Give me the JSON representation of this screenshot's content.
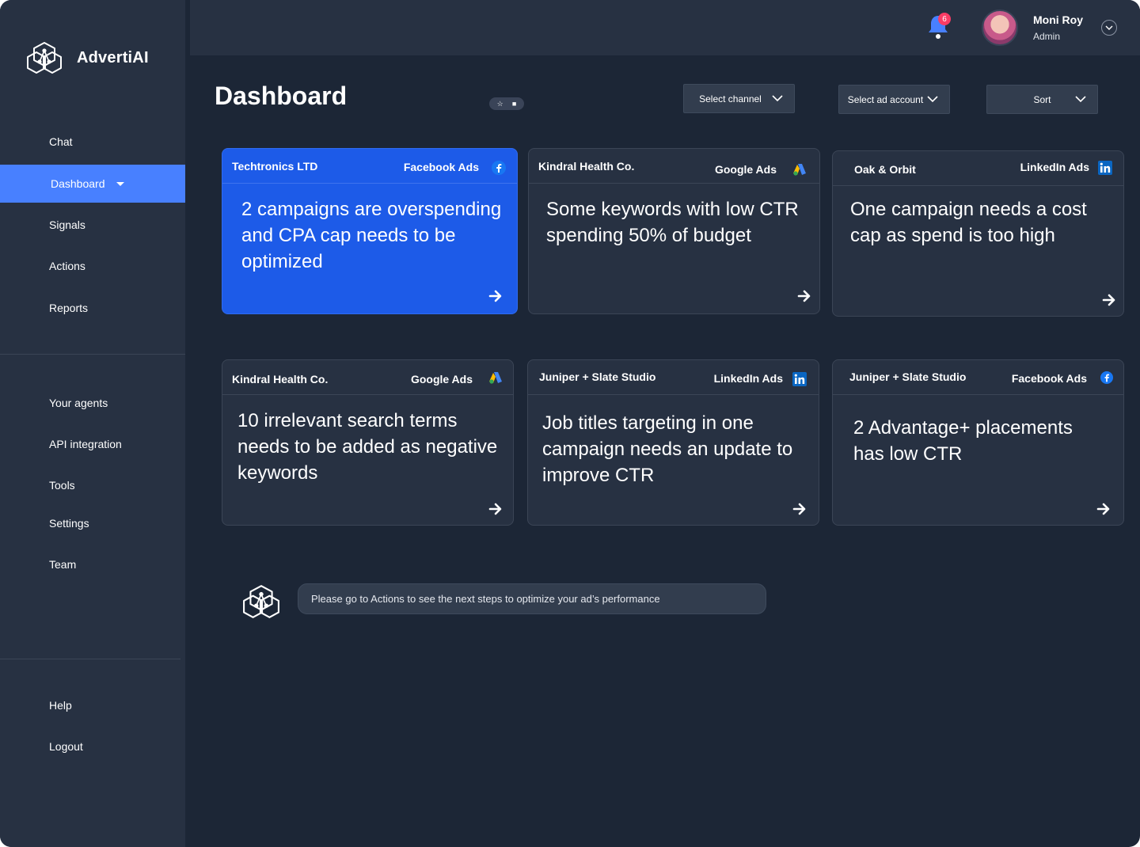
{
  "app": {
    "name": "AdvertiAI"
  },
  "sidebar": {
    "items": [
      {
        "label": "Chat"
      },
      {
        "label": "Dashboard"
      },
      {
        "label": "Signals"
      },
      {
        "label": "Actions"
      },
      {
        "label": "Reports"
      },
      {
        "label": "Your agents"
      },
      {
        "label": "API integration"
      },
      {
        "label": "Tools"
      },
      {
        "label": "Settings"
      },
      {
        "label": "Team"
      },
      {
        "label": "Help"
      },
      {
        "label": "Logout"
      }
    ],
    "active_item": "Dashboard"
  },
  "topbar": {
    "notification_count": "6",
    "user_name": "Moni Roy",
    "user_role": "Admin"
  },
  "header": {
    "title": "Dashboard",
    "filters": {
      "channel": "Select channel",
      "ad_account": "Select ad account",
      "sort": "Sort"
    }
  },
  "cards": [
    {
      "company": "Techtronics LTD",
      "platform": "Facebook Ads",
      "platform_icon": "facebook-icon",
      "text": "2 campaigns are overspending and CPA cap needs to be optimized",
      "highlighted": true
    },
    {
      "company": "Kindral Health Co.",
      "platform": "Google Ads",
      "platform_icon": "google-ads-icon",
      "text": "Some keywords with low CTR spending 50% of budget"
    },
    {
      "company": "Oak & Orbit",
      "platform": "LinkedIn Ads",
      "platform_icon": "linkedin-icon",
      "text": "One campaign needs a cost cap as spend is too high"
    },
    {
      "company": "Kindral Health Co.",
      "platform": "Google Ads",
      "platform_icon": "google-ads-icon",
      "text": "10 irrelevant search terms needs to be added as negative keywords"
    },
    {
      "company": "Juniper + Slate Studio",
      "platform": "LinkedIn Ads",
      "platform_icon": "linkedin-icon",
      "text": "Job titles targeting in one campaign needs an update to improve CTR"
    },
    {
      "company": "Juniper + Slate Studio",
      "platform": "Facebook Ads",
      "platform_icon": "facebook-icon",
      "text": "2 Advantage+ placements has low CTR"
    }
  ],
  "chat": {
    "message": "Please go to Actions to see  the next steps to optimize your ad’s performance"
  },
  "colors": {
    "background": "#1c2636",
    "panel": "#273142",
    "accent": "#4880ff",
    "highlight_card": "#1d5be8",
    "badge": "#f93c65"
  }
}
